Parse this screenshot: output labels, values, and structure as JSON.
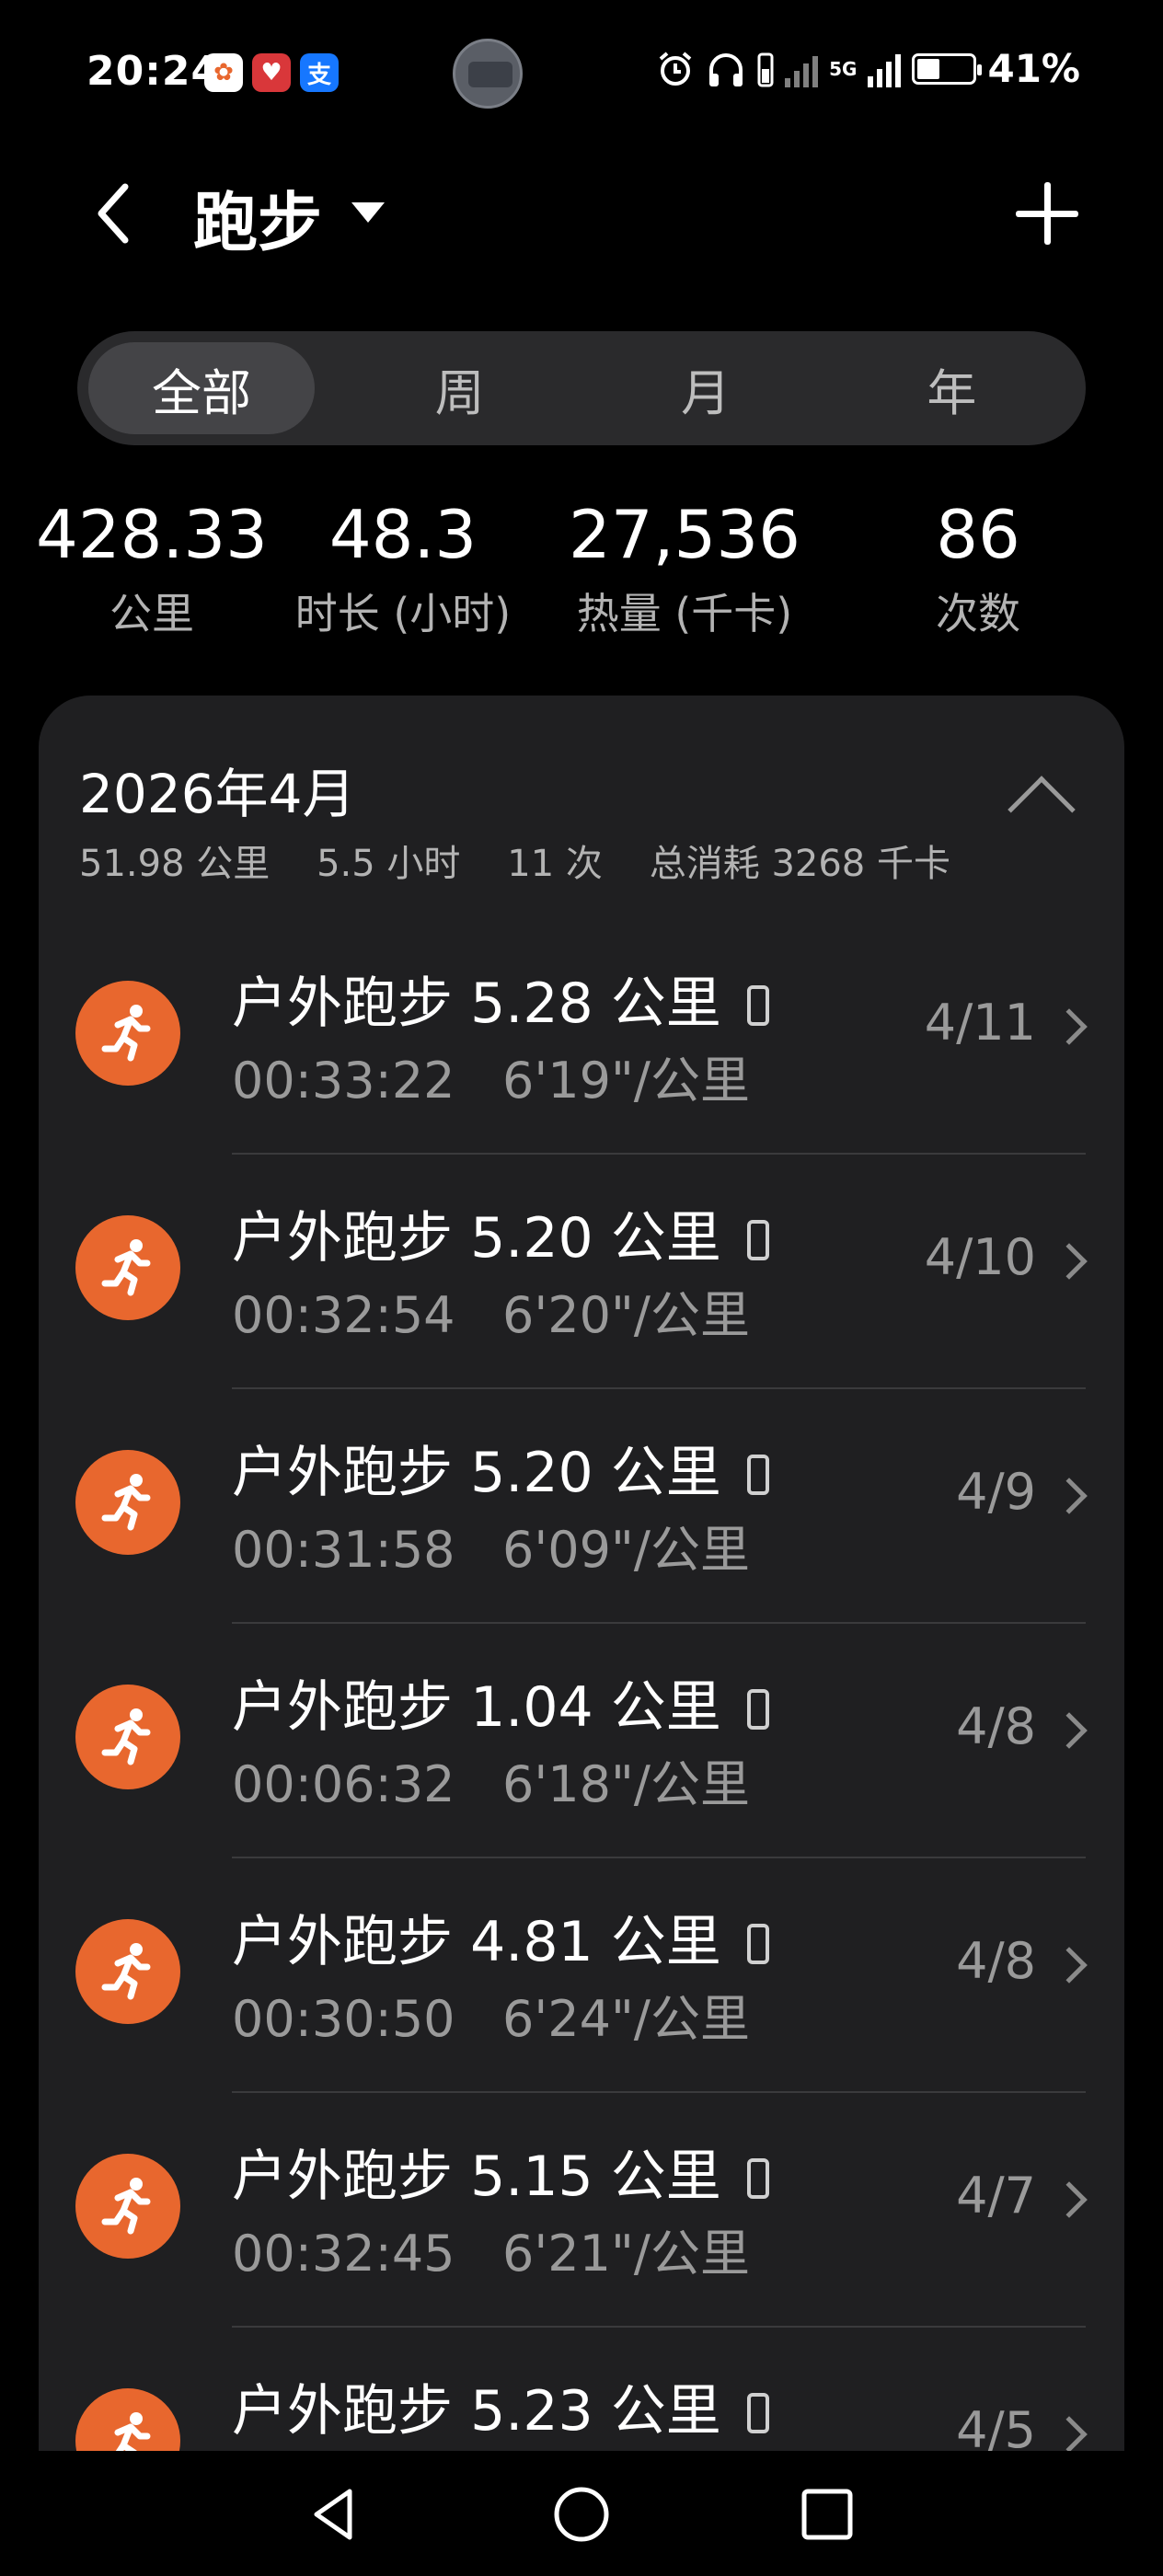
{
  "status_bar": {
    "time": "20:24",
    "apps": [
      {
        "name": "app-colorful",
        "glyph": "✿",
        "bg": "#ffffff",
        "fg": "#e8672e"
      },
      {
        "name": "app-heart",
        "glyph": "♥",
        "bg": "#d9373a",
        "fg": "#ffffff"
      },
      {
        "name": "alipay",
        "glyph": "支",
        "bg": "#1677ff",
        "fg": "#ffffff"
      }
    ],
    "network": "5G",
    "battery_pct": "41%",
    "battery_level": 0.41
  },
  "header": {
    "title": "跑步"
  },
  "tabs": [
    {
      "label": "全部",
      "active": true
    },
    {
      "label": "周",
      "active": false
    },
    {
      "label": "月",
      "active": false
    },
    {
      "label": "年",
      "active": false
    }
  ],
  "stats": [
    {
      "value": "428.33",
      "label": "公里"
    },
    {
      "value": "48.3",
      "label": "时长 (小时)"
    },
    {
      "value": "27,536",
      "label": "热量 (千卡)"
    },
    {
      "value": "86",
      "label": "次数"
    }
  ],
  "month": {
    "title": "2026年4月",
    "summary": "51.98 公里    5.5 小时    11 次    总消耗 3268 千卡"
  },
  "records": [
    {
      "title": "户外跑步 5.28 公里",
      "duration": "00:33:22",
      "pace": "6'19\"/公里",
      "date": "4/11"
    },
    {
      "title": "户外跑步 5.20 公里",
      "duration": "00:32:54",
      "pace": "6'20\"/公里",
      "date": "4/10"
    },
    {
      "title": "户外跑步 5.20 公里",
      "duration": "00:31:58",
      "pace": "6'09\"/公里",
      "date": "4/9"
    },
    {
      "title": "户外跑步 1.04 公里",
      "duration": "00:06:32",
      "pace": "6'18\"/公里",
      "date": "4/8"
    },
    {
      "title": "户外跑步 4.81 公里",
      "duration": "00:30:50",
      "pace": "6'24\"/公里",
      "date": "4/8"
    },
    {
      "title": "户外跑步 5.15 公里",
      "duration": "00:32:45",
      "pace": "6'21\"/公里",
      "date": "4/7"
    },
    {
      "title": "户外跑步 5.23 公里",
      "duration": "",
      "pace": "",
      "date": "4/5"
    }
  ],
  "colors": {
    "accent": "#e8672e",
    "card_bg": "#1f1f21",
    "secondary_text": "#9a9a9a"
  }
}
